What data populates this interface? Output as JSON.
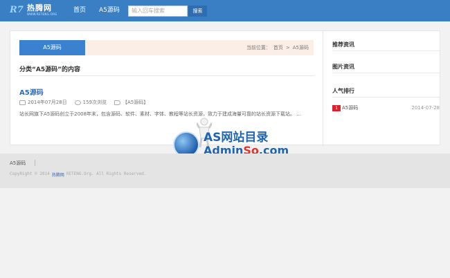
{
  "header": {
    "logo_mark": "R7",
    "logo_name": "热腾网",
    "logo_domain": "WWW.RETENG.ORG",
    "nav": [
      "首页",
      "A5源码"
    ],
    "search_placeholder": "输入回车搜索",
    "search_button": "搜索"
  },
  "breadcrumb": {
    "active_tab": "A5源码",
    "prefix": "当前位置：",
    "home": "首页",
    "separator": ">",
    "current": "A5源码"
  },
  "category": {
    "title": "分类“A5源码”的内容"
  },
  "post": {
    "title": "A5源码",
    "date": "2014年07月28日",
    "views": "159次浏览",
    "tag": "【A5源码】",
    "excerpt": "站长网旗下A5源码创立于2008年末，包含源码、软件、素材、字体、教程等站长资源，致力于建成海量可靠的站长资源下载站。 ..."
  },
  "sidebar": {
    "recommended_heading": "推荐资讯",
    "images_heading": "图片资讯",
    "popular_heading": "人气排行",
    "popular": [
      {
        "rank": "1",
        "title": "A5源码",
        "date": "2014-07-28"
      }
    ]
  },
  "watermark": {
    "line1": "AS网站目录",
    "line2_blue": "Admin",
    "line2_red": "So",
    "line2_tail": ".com"
  },
  "footer": {
    "link": "A5源码",
    "copyright_pre": "CopyRight © 2014",
    "copyright_brand": "热腾网",
    "copyright_post": "RETENG.Org. All Rights Reserved."
  }
}
